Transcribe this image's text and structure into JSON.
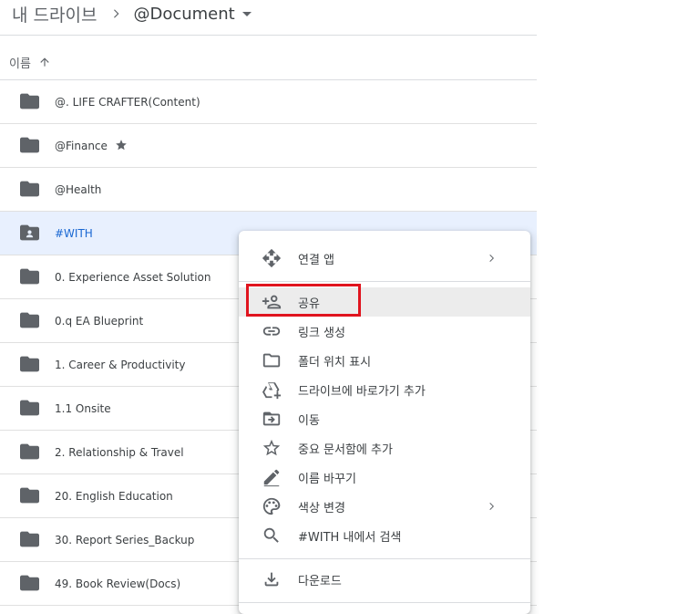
{
  "breadcrumb": {
    "root": "내 드라이브",
    "current": "@Document"
  },
  "column_header": {
    "name": "이름"
  },
  "files": [
    {
      "name": "@. LIFE CRAFTER(Content)",
      "icon": "folder-icon"
    },
    {
      "name": "@Finance",
      "icon": "folder-icon",
      "starred": true
    },
    {
      "name": "@Health",
      "icon": "folder-icon"
    },
    {
      "name": "#WITH",
      "icon": "shared-folder-icon",
      "selected": true
    },
    {
      "name": "0. Experience Asset Solution",
      "icon": "folder-icon"
    },
    {
      "name": "0.q EA Blueprint",
      "icon": "folder-icon"
    },
    {
      "name": "1. Career & Productivity",
      "icon": "folder-icon"
    },
    {
      "name": "1.1 Onsite",
      "icon": "folder-icon"
    },
    {
      "name": "2. Relationship & Travel",
      "icon": "folder-icon"
    },
    {
      "name": "20. English Education",
      "icon": "folder-icon"
    },
    {
      "name": "30. Report Series_Backup",
      "icon": "folder-icon"
    },
    {
      "name": "49. Book Review(Docs)",
      "icon": "folder-icon"
    }
  ],
  "context_menu": {
    "items": [
      {
        "label": "연결 앱",
        "icon": "open-with-icon",
        "submenu": true
      },
      {
        "label": "공유",
        "icon": "share-person-icon",
        "highlighted": true
      },
      {
        "label": "링크 생성",
        "icon": "link-icon"
      },
      {
        "label": "폴더 위치 표시",
        "icon": "folder-outline-icon"
      },
      {
        "label": "드라이브에 바로가기 추가",
        "icon": "drive-shortcut-icon"
      },
      {
        "label": "이동",
        "icon": "move-icon"
      },
      {
        "label": "중요 문서함에 추가",
        "icon": "star-outline-icon"
      },
      {
        "label": "이름 바꾸기",
        "icon": "pencil-icon"
      },
      {
        "label": "색상 변경",
        "icon": "palette-icon",
        "submenu": true
      },
      {
        "label": "#WITH 내에서 검색",
        "icon": "search-icon"
      },
      {
        "label": "다운로드",
        "icon": "download-icon"
      }
    ]
  },
  "colors": {
    "selection_bg": "#e8f0fe",
    "selection_text": "#1967d2",
    "annotation_red": "#e0141e",
    "menu_highlight": "#ececec"
  }
}
